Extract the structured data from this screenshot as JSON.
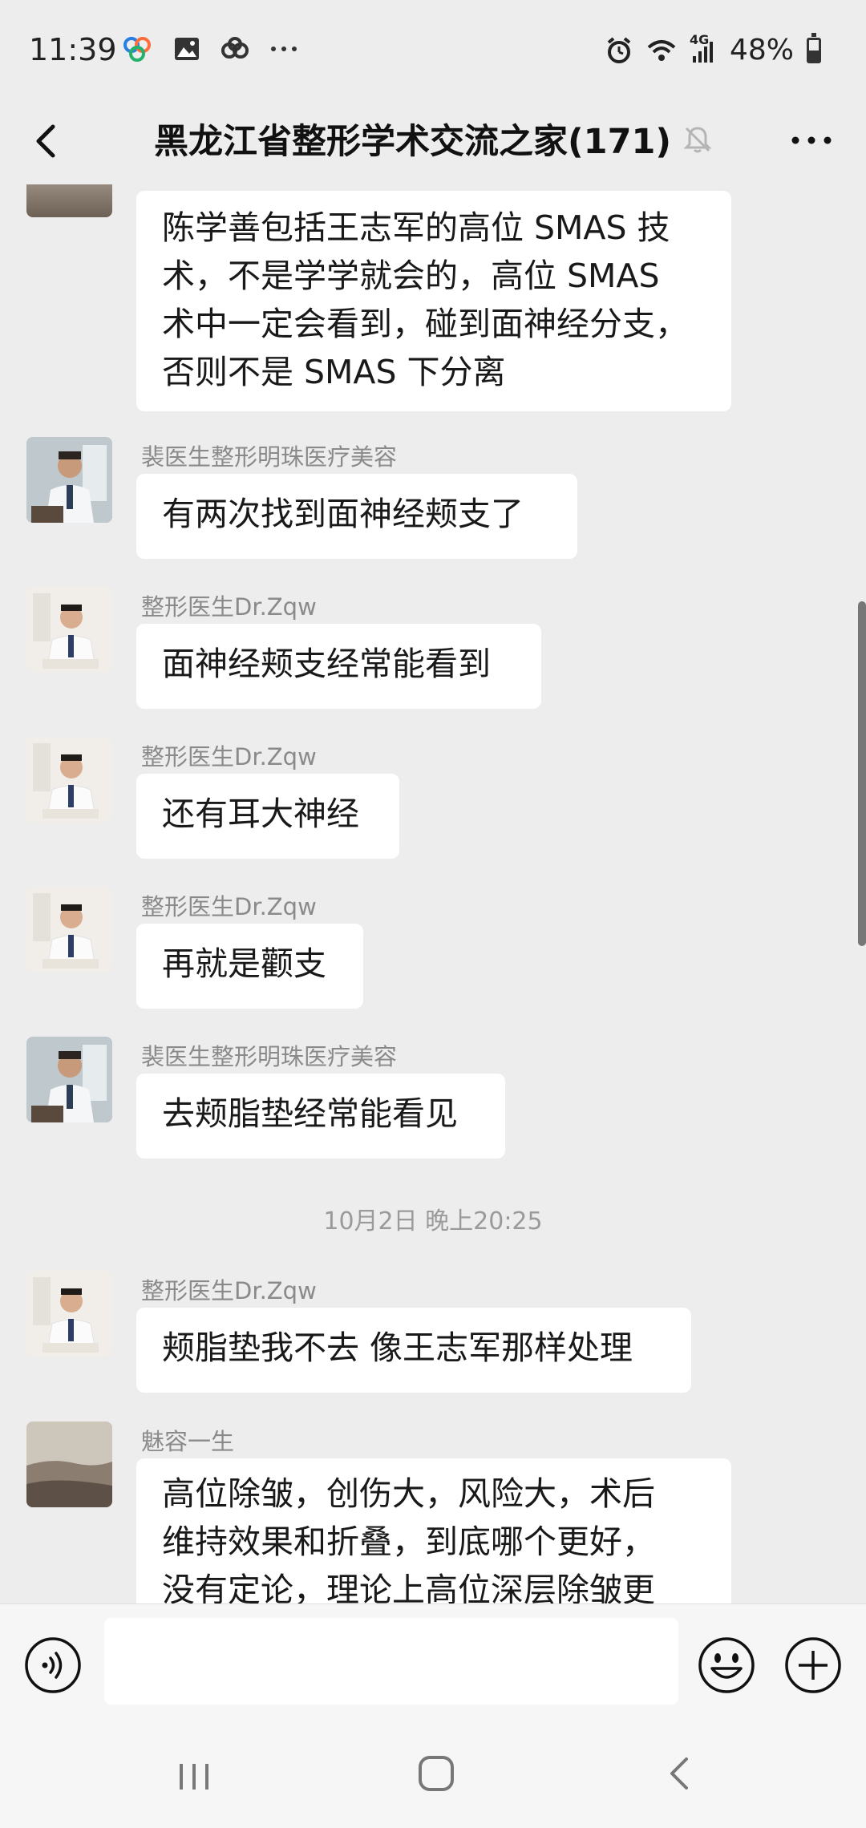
{
  "status_bar": {
    "time": "11:39",
    "network": "4G",
    "battery_text": "48%",
    "battery_level": 0.48,
    "left_icons": [
      "app-icon",
      "image-icon",
      "link-icon",
      "more-dots-icon"
    ],
    "right_icons": [
      "alarm-icon",
      "wifi-icon",
      "signal-icon",
      "battery-icon"
    ]
  },
  "header": {
    "title": "黑龙江省整形学术交流之家(171)"
  },
  "messages": [
    {
      "type": "text",
      "avatar": "landscape",
      "sender": "",
      "lines": [
        "陈学善包括王志军的高位 SMAS 技",
        "术，不是学学就会的，高位 SMAS",
        "术中一定会看到，碰到面神经分支，",
        "否则不是 SMAS 下分离"
      ]
    },
    {
      "type": "text",
      "avatar": "doctor1",
      "sender": "裴医生整形明珠医疗美容",
      "lines": [
        "有两次找到面神经颊支了"
      ]
    },
    {
      "type": "text",
      "avatar": "doctor2",
      "sender": "整形医生Dr.Zqw",
      "lines": [
        "面神经颊支经常能看到"
      ]
    },
    {
      "type": "text",
      "avatar": "doctor2",
      "sender": "整形医生Dr.Zqw",
      "lines": [
        "还有耳大神经"
      ]
    },
    {
      "type": "text",
      "avatar": "doctor2",
      "sender": "整形医生Dr.Zqw",
      "lines": [
        "再就是颧支"
      ]
    },
    {
      "type": "text",
      "avatar": "doctor1",
      "sender": "裴医生整形明珠医疗美容",
      "lines": [
        "去颊脂垫经常能看见"
      ]
    },
    {
      "type": "timestamp",
      "text": "10月2日 晚上20:25"
    },
    {
      "type": "text",
      "avatar": "doctor2",
      "sender": "整形医生Dr.Zqw",
      "lines": [
        "颊脂垫我不去 像王志军那样处理"
      ]
    },
    {
      "type": "text",
      "avatar": "landscape",
      "sender": "魅容一生",
      "lines": [
        "高位除皱，创伤大，风险大，术后",
        "维持效果和折叠，到底哪个更好，",
        "没有定论，理论上高位深层除皱更"
      ]
    }
  ],
  "input": {
    "placeholder": "",
    "value": ""
  },
  "icons": {
    "back": "chevron-left-icon",
    "mute": "bell-mute-icon",
    "more": "more-dots-icon",
    "voice": "voice-icon",
    "emoji": "emoji-icon",
    "plus": "plus-icon"
  },
  "colors": {
    "background": "#ededed",
    "bubble": "#ffffff",
    "sender_text": "#8a8a8a",
    "timestamp_text": "#9a9a9a"
  }
}
